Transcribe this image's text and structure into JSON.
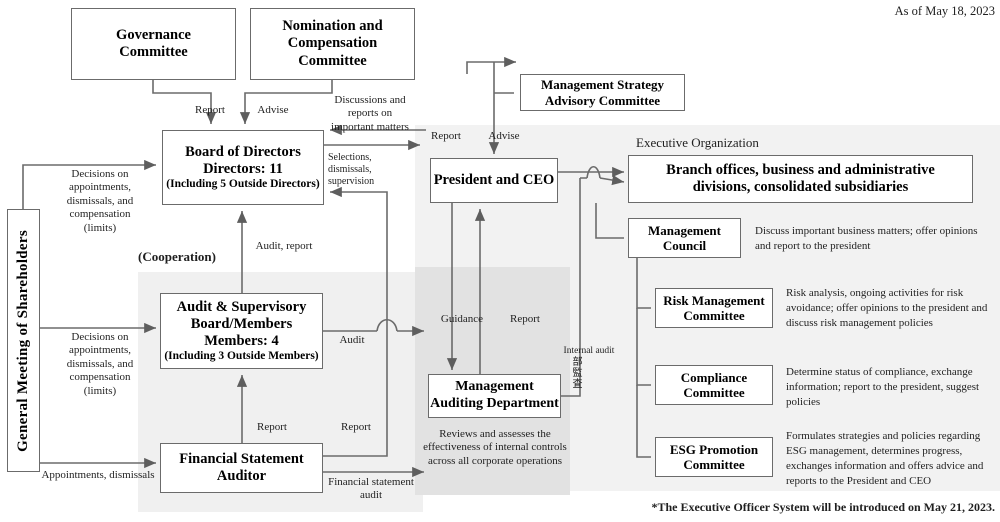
{
  "header": {
    "date_note": "As of May 18, 2023"
  },
  "footer": {
    "note": "*The Executive Officer System will be introduced on May 21, 2023."
  },
  "boxes": {
    "governance_committee": {
      "line1": "Governance",
      "line2": "Committee"
    },
    "nomination_committee": {
      "line1": "Nomination and",
      "line2": "Compensation",
      "line3": "Committee"
    },
    "board_of_directors": {
      "line1": "Board of Directors",
      "line2": "Directors: 11",
      "line3": "(Including 5 Outside Directors)"
    },
    "audit_supervisory_board": {
      "line1": "Audit & Supervisory",
      "line2": "Board/Members",
      "line3": "Members: 4",
      "line4": "(Including 3 Outside Members)"
    },
    "financial_statement_auditor": {
      "line1": "Financial Statement",
      "line2": "Auditor"
    },
    "general_meeting_of_shareholders": {
      "label": "General Meeting of Shareholders"
    },
    "management_strategy_advisory_committee": {
      "line1": "Management Strategy",
      "line2": "Advisory Committee"
    },
    "president_and_ceo": {
      "label": "President and CEO"
    },
    "branch_offices": {
      "line1": "Branch offices, business and administrative",
      "line2": "divisions, consolidated subsidiaries"
    },
    "management_council": {
      "line1": "Management",
      "line2": "Council"
    },
    "risk_management_committee": {
      "line1": "Risk Management",
      "line2": "Committee"
    },
    "compliance_committee": {
      "line1": "Compliance",
      "line2": "Committee"
    },
    "esg_promotion_committee": {
      "line1": "ESG Promotion",
      "line2": "Committee"
    },
    "management_auditing_department": {
      "line1": "Management",
      "line2": "Auditing Department"
    }
  },
  "panels": {
    "executive_organization_label": "Executive Organization"
  },
  "edge_labels": {
    "report_to_board": "Report",
    "advise_to_board": "Advise",
    "discussions_important_matters": "Discussions and\nreports on\nimportant matters",
    "selections_dismissals_supervision": "Selections,\ndismissals,\nsupervision",
    "decisions_appointments_board": "Decisions on\nappointments,\ndismissals, and\ncompensation (limits)",
    "decisions_appointments_asb": "Decisions on\nappointments,\ndismissals, and\ncompensation (limits)",
    "appointments_dismissals": "Appointments, dismissals",
    "cooperation": "(Cooperation)",
    "audit_report": "Audit, report",
    "audit": "Audit",
    "report_asb": "Report",
    "report_board": "Report",
    "financial_statement_audit": "Financial statement\naudit",
    "report_to_msac": "Report",
    "advise_from_msac": "Advise",
    "guidance": "Guidance",
    "report_from_mad": "Report",
    "internal_audit": "Internal audit",
    "internal_audit_jp": "部監査"
  },
  "descriptions": {
    "management_council": "Discuss important business matters; offer opinions and report to the president",
    "risk_management_committee": "Risk analysis, ongoing activities for risk avoidance; offer opinions to the president and discuss risk management policies",
    "compliance_committee": "Determine status of compliance, exchange information; report to the president, suggest policies",
    "esg_promotion_committee": "Formulates strategies and policies regarding ESG management, determines progress, exchanges information and offers advice and reports to the President and CEO",
    "management_auditing_department": "Reviews and assesses the effectiveness of internal controls across all corporate operations"
  },
  "colors": {
    "box_border": "#6b6b6b",
    "panel_left": "#f0f0f0",
    "panel_outer": "#f2f2f2",
    "panel_inner": "#e2e2e2",
    "wire": "#6b6b6b"
  }
}
